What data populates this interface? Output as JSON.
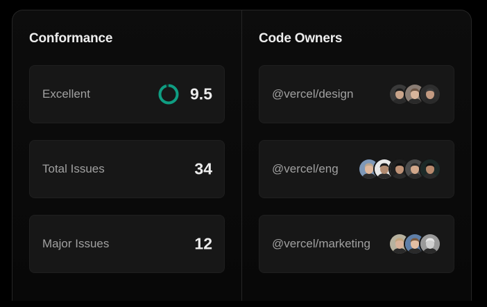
{
  "conformance": {
    "title": "Conformance",
    "metrics": [
      {
        "label": "Excellent",
        "value": "9.5",
        "score_fraction": 0.95,
        "ring_color": "#0f9d82",
        "ring_track": "#0e3b33"
      },
      {
        "label": "Total Issues",
        "value": "34"
      },
      {
        "label": "Major Issues",
        "value": "12"
      }
    ]
  },
  "code_owners": {
    "title": "Code Owners",
    "teams": [
      {
        "handle": "@vercel/design",
        "avatars": [
          {
            "bg": "#3a3a3a",
            "skin": "#c9a48a",
            "hair": "#1c1c1c"
          },
          {
            "bg": "#8a7d74",
            "skin": "#d8b59c",
            "hair": "#6b5444"
          },
          {
            "bg": "#2e2e2e",
            "skin": "#c49b82",
            "hair": "#3a3a3a"
          }
        ]
      },
      {
        "handle": "@vercel/eng",
        "avatars": [
          {
            "bg": "#7e98b8",
            "skin": "#e0b89c",
            "hair": "#b9a58e"
          },
          {
            "bg": "#e8e8e8",
            "skin": "#b08a70",
            "hair": "#1a1a1a"
          },
          {
            "bg": "#202020",
            "skin": "#c09377",
            "hair": "#101010"
          },
          {
            "bg": "#4b4b4b",
            "skin": "#d1a78b",
            "hair": "#2b2b2b"
          },
          {
            "bg": "#1c2a28",
            "skin": "#b88a6d",
            "hair": "#111111"
          }
        ]
      },
      {
        "handle": "@vercel/marketing",
        "avatars": [
          {
            "bg": "#b7b29f",
            "skin": "#d9b299",
            "hair": "#c2a47c"
          },
          {
            "bg": "#5f7fa8",
            "skin": "#e2bea3",
            "hair": "#7a5a40"
          },
          {
            "bg": "#9a9a9a",
            "skin": "#cfcfcf",
            "hair": "#e6e6e6"
          }
        ]
      }
    ]
  },
  "colors": {
    "background": "#000000",
    "panel_border": "#262626",
    "card": "#171717",
    "text_primary": "#ededed",
    "text_secondary": "#a1a1a1",
    "accent": "#0f9d82"
  }
}
